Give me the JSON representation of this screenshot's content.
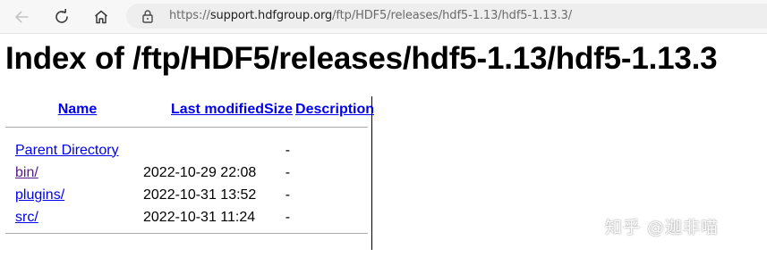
{
  "browser": {
    "back_icon": "arrow-left-icon",
    "reload_icon": "reload-icon",
    "home_icon": "home-icon",
    "lock_icon": "lock-icon",
    "url_prefix": "https://",
    "url_host": "support.hdfgroup.org",
    "url_path": "/ftp/HDF5/releases/hdf5-1.13/hdf5-1.13.3/"
  },
  "page": {
    "title": "Index of /ftp/HDF5/releases/hdf5-1.13/hdf5-1.13.3"
  },
  "table": {
    "headers": {
      "name": "Name",
      "last_modified": "Last modified",
      "size": "Size",
      "description": "Description"
    },
    "rows": [
      {
        "name": "Parent Directory",
        "modified": "",
        "size": "-",
        "visited": false
      },
      {
        "name": "bin/",
        "modified": "2022-10-29 22:08",
        "size": "-",
        "visited": true
      },
      {
        "name": "plugins/",
        "modified": "2022-10-31 13:52",
        "size": "-",
        "visited": false
      },
      {
        "name": "src/",
        "modified": "2022-10-31 11:24",
        "size": "-",
        "visited": false
      }
    ]
  },
  "watermark": {
    "text": "知乎 @迦非喵"
  },
  "colors": {
    "link": "#0000ee",
    "visited_link": "#551a8b",
    "toolbar_bg": "#f7f7f7",
    "address_bg": "#eeeeee"
  }
}
